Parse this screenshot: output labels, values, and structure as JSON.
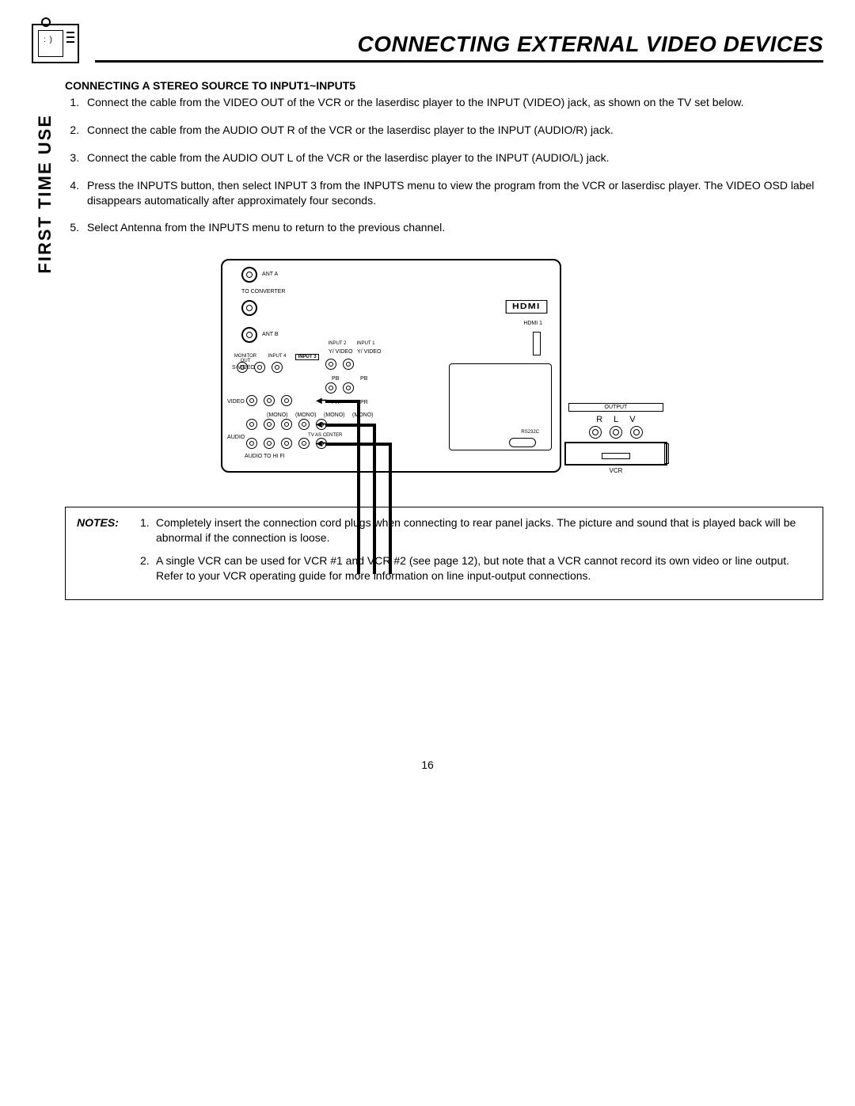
{
  "header": {
    "title": "CONNECTING EXTERNAL VIDEO DEVICES"
  },
  "side_label": "FIRST TIME USE",
  "section": {
    "subhead": "CONNECTING A STEREO SOURCE TO INPUT1~INPUT5",
    "steps": [
      "Connect the cable from the VIDEO OUT of the VCR or the laserdisc player to the INPUT (VIDEO) jack, as shown on the TV set below.",
      "Connect the cable from the AUDIO OUT R of the VCR or the laserdisc player to the INPUT (AUDIO/R) jack.",
      "Connect the cable from the AUDIO OUT L of the VCR or the laserdisc player to the INPUT (AUDIO/L) jack.",
      "Press the INPUTS button, then select INPUT 3 from the INPUTS menu to view the program from the VCR or laserdisc player. The VIDEO OSD label disappears automatically after approximately four seconds.",
      "Select Antenna from the INPUTS menu to return to the previous channel."
    ]
  },
  "diagram": {
    "ant_a": "ANT A",
    "to_converter": "TO CONVERTER",
    "ant_b": "ANT B",
    "hdmi_logo": "HDMI",
    "hdmi1": "HDMI 1",
    "monitor_out": "MONITOR OUT",
    "input4": "INPUT 4",
    "input3": "INPUT 3",
    "input2": "INPUT 2",
    "input1": "INPUT 1",
    "svideo": "S-VIDEO",
    "y_video": "Y/ VIDEO",
    "pb": "PB",
    "pr": "PR",
    "video_row": "VIDEO",
    "mono": "(MONO)",
    "audio_row": "AUDIO",
    "audio_to_hifi": "AUDIO TO HI FI",
    "tv_as_center": "TV AS CENTER",
    "rs232c": "RS232C",
    "output": "OUTPUT",
    "r": "R",
    "l": "L",
    "v": "V",
    "vcr": "VCR"
  },
  "notes": {
    "label": "NOTES:",
    "items": [
      "Completely insert the connection cord plugs when connecting to rear panel jacks.  The picture and sound that is played back will be abnormal if the connection is loose.",
      "A single VCR can be used for VCR #1 and VCR #2 (see page 12), but note that a VCR cannot record its own video or line output.  Refer to your VCR operating guide for more information on line input-output connections."
    ]
  },
  "page_number": "16"
}
